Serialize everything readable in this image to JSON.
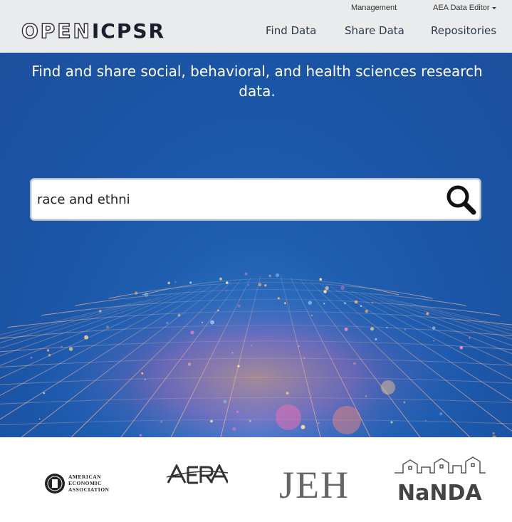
{
  "header": {
    "logo_open": "OPEN",
    "logo_icpsr": "ICPSR",
    "top_links": {
      "management": "Management",
      "editor": "AEA Data Editor"
    },
    "nav": {
      "find": "Find Data",
      "share": "Share Data",
      "repositories": "Repositories"
    }
  },
  "hero": {
    "tagline": "Find and share social, behavioral, and health sciences research data."
  },
  "search": {
    "value": "race and ethni",
    "icon": "search-icon"
  },
  "partners": {
    "aea_lines": [
      "AMERICAN",
      "ECONOMIC",
      "ASSOCIATION"
    ],
    "aera": "AERA",
    "jeh": "JEH",
    "nanda": "NaNDA"
  },
  "colors": {
    "header_bg": "#e9ebed",
    "hero_blue": "#1f5fb0",
    "nav_text": "#2d3a4a"
  }
}
